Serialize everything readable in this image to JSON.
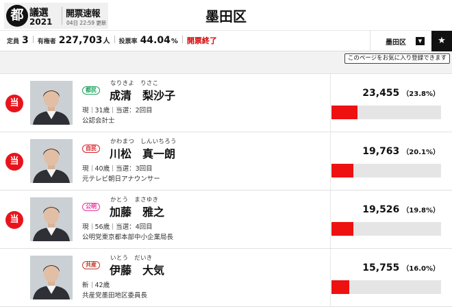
{
  "header": {
    "logo_mark": "都",
    "logo_election": "議選",
    "logo_year": "2021",
    "logo_title": "開票速報",
    "logo_updated": "04日 22:59 更新",
    "ward_title": "墨田区"
  },
  "stats": {
    "seats_label": "定員",
    "seats_value": "3",
    "voters_label": "有権者",
    "voters_value": "227,703",
    "voters_unit": "人",
    "turnout_label": "投票率",
    "turnout_value": "44.04",
    "turnout_unit": "%",
    "status": "開票終了"
  },
  "ward_select": {
    "label": "墨田区",
    "icon": "caret-down-icon"
  },
  "favorite": {
    "icon": "star-icon",
    "tooltip": "このページをお気に入り登録できます"
  },
  "candidates": [
    {
      "elected": true,
      "elected_mark": "当",
      "party": "都民",
      "party_color": "#19a05a",
      "kana": "なりきよ　りさこ",
      "name": "成清　梨沙子",
      "status": "現",
      "age": "31歳",
      "terms": "当選：2回目",
      "career": "公認会計士",
      "votes": "23,455",
      "percent_label": "（23.8%）",
      "bar_share": 0.238
    },
    {
      "elected": true,
      "elected_mark": "当",
      "party": "自民",
      "party_color": "#d8232a",
      "kana": "かわまつ　しんいちろう",
      "name": "川松　真一朗",
      "status": "現",
      "age": "40歳",
      "terms": "当選：3回目",
      "career": "元テレビ朝日アナウンサー",
      "votes": "19,763",
      "percent_label": "（20.1%）",
      "bar_share": 0.201
    },
    {
      "elected": true,
      "elected_mark": "当",
      "party": "公明",
      "party_color": "#e8339b",
      "kana": "かとう　まさゆき",
      "name": "加藤　雅之",
      "status": "現",
      "age": "56歳",
      "terms": "当選：4回目",
      "career": "公明党東京都本部中小企業局長",
      "votes": "19,526",
      "percent_label": "（19.8%）",
      "bar_share": 0.198
    },
    {
      "elected": false,
      "elected_mark": "",
      "party": "共産",
      "party_color": "#c0392b",
      "kana": "いとう　だいき",
      "name": "伊藤　大気",
      "status": "新",
      "age": "42歳",
      "terms": "",
      "career": "共産党墨田地区委員長",
      "votes": "15,755",
      "percent_label": "（16.0%）",
      "bar_share": 0.16
    }
  ]
}
